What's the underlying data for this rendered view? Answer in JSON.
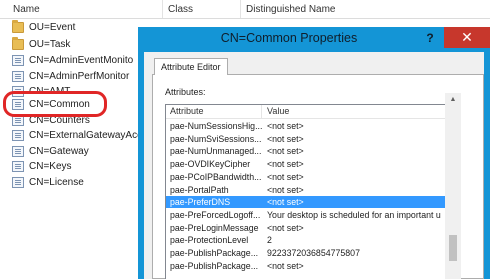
{
  "explorer": {
    "columns": {
      "name": "Name",
      "class": "Class",
      "dn": "Distinguished Name"
    },
    "items": [
      {
        "label": "OU=Event",
        "icon": "folder-icon"
      },
      {
        "label": "OU=Task",
        "icon": "folder-icon"
      },
      {
        "label": "CN=AdminEventMonito",
        "icon": "object-icon"
      },
      {
        "label": "CN=AdminPerfMonitor",
        "icon": "object-icon"
      },
      {
        "label": "CN=AMT",
        "icon": "object-icon"
      },
      {
        "label": "CN=Common",
        "icon": "object-icon"
      },
      {
        "label": "CN=Counters",
        "icon": "object-icon"
      },
      {
        "label": "CN=ExternalGatewayAcc",
        "icon": "object-icon"
      },
      {
        "label": "CN=Gateway",
        "icon": "object-icon"
      },
      {
        "label": "CN=Keys",
        "icon": "object-icon"
      },
      {
        "label": "CN=License",
        "icon": "object-icon"
      }
    ]
  },
  "dialog": {
    "title": "CN=Common Properties",
    "help_glyph": "?",
    "close_glyph": "✕",
    "tab_label": "Attribute Editor",
    "attributes_label": "Attributes:",
    "columns": {
      "attribute": "Attribute",
      "value": "Value"
    },
    "rows": [
      {
        "attribute": "pae-NumSessionsHig...",
        "value": "<not set>"
      },
      {
        "attribute": "pae-NumSviSessions...",
        "value": "<not set>"
      },
      {
        "attribute": "pae-NumUnmanaged...",
        "value": "<not set>"
      },
      {
        "attribute": "pae-OVDIKeyCipher",
        "value": "<not set>"
      },
      {
        "attribute": "pae-PCoIPBandwidth...",
        "value": "<not set>"
      },
      {
        "attribute": "pae-PortalPath",
        "value": "<not set>"
      },
      {
        "attribute": "pae-PreferDNS",
        "value": "<not set>",
        "selected": true
      },
      {
        "attribute": "pae-PreForcedLogoff...",
        "value": "Your desktop is scheduled for an important u"
      },
      {
        "attribute": "pae-PreLoginMessage",
        "value": "<not set>"
      },
      {
        "attribute": "pae-ProtectionLevel",
        "value": "2"
      },
      {
        "attribute": "pae-PublishPackage...",
        "value": "9223372036854775807"
      },
      {
        "attribute": "pae-PublishPackage...",
        "value": "<not set>"
      }
    ]
  },
  "colors": {
    "dialog_frame": "#1495d6",
    "close_button": "#c7372c",
    "selection": "#3399ff",
    "highlight_ring": "#e02626"
  }
}
